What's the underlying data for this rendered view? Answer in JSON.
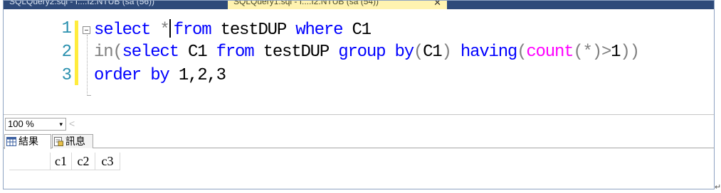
{
  "tabs": [
    {
      "label": "SQLQuery2.sql - I....I2.NTUB (sa (56))",
      "active": false
    },
    {
      "label": "SQLQuery1.sql - I....I2.NTUB (sa (54))",
      "active": true,
      "close_glyph": "✕"
    }
  ],
  "editor": {
    "line_numbers": [
      "1",
      "2",
      "3"
    ],
    "line1": {
      "select": "select",
      "star": "*",
      "from": "from",
      "table": "testDUP",
      "where": "where",
      "col": "C1"
    },
    "line2": {
      "in": "in",
      "lparen": "(",
      "select": "select",
      "col": "C1",
      "from": "from",
      "table": "testDUP",
      "group_by": "group by",
      "lparen2": "(",
      "col2": "C1",
      "rparen2": ")",
      "having": "having",
      "lparen3": "(",
      "count": "count",
      "inner": "(*)",
      "gt": ">",
      "one": "1",
      "rparen3": ")",
      "rparen": ")"
    },
    "line3": {
      "order_by": "order by",
      "cols": "1,2,3"
    }
  },
  "zoom": {
    "value": "100 %",
    "arrow": "▾"
  },
  "scroll_left_glyph": "<",
  "result_tabs": [
    {
      "label": "結果",
      "icon": "grid-icon"
    },
    {
      "label": "訊息",
      "icon": "messages-icon"
    }
  ],
  "grid": {
    "columns": [
      "c1",
      "c2",
      "c3"
    ]
  },
  "return_mark": "↵"
}
